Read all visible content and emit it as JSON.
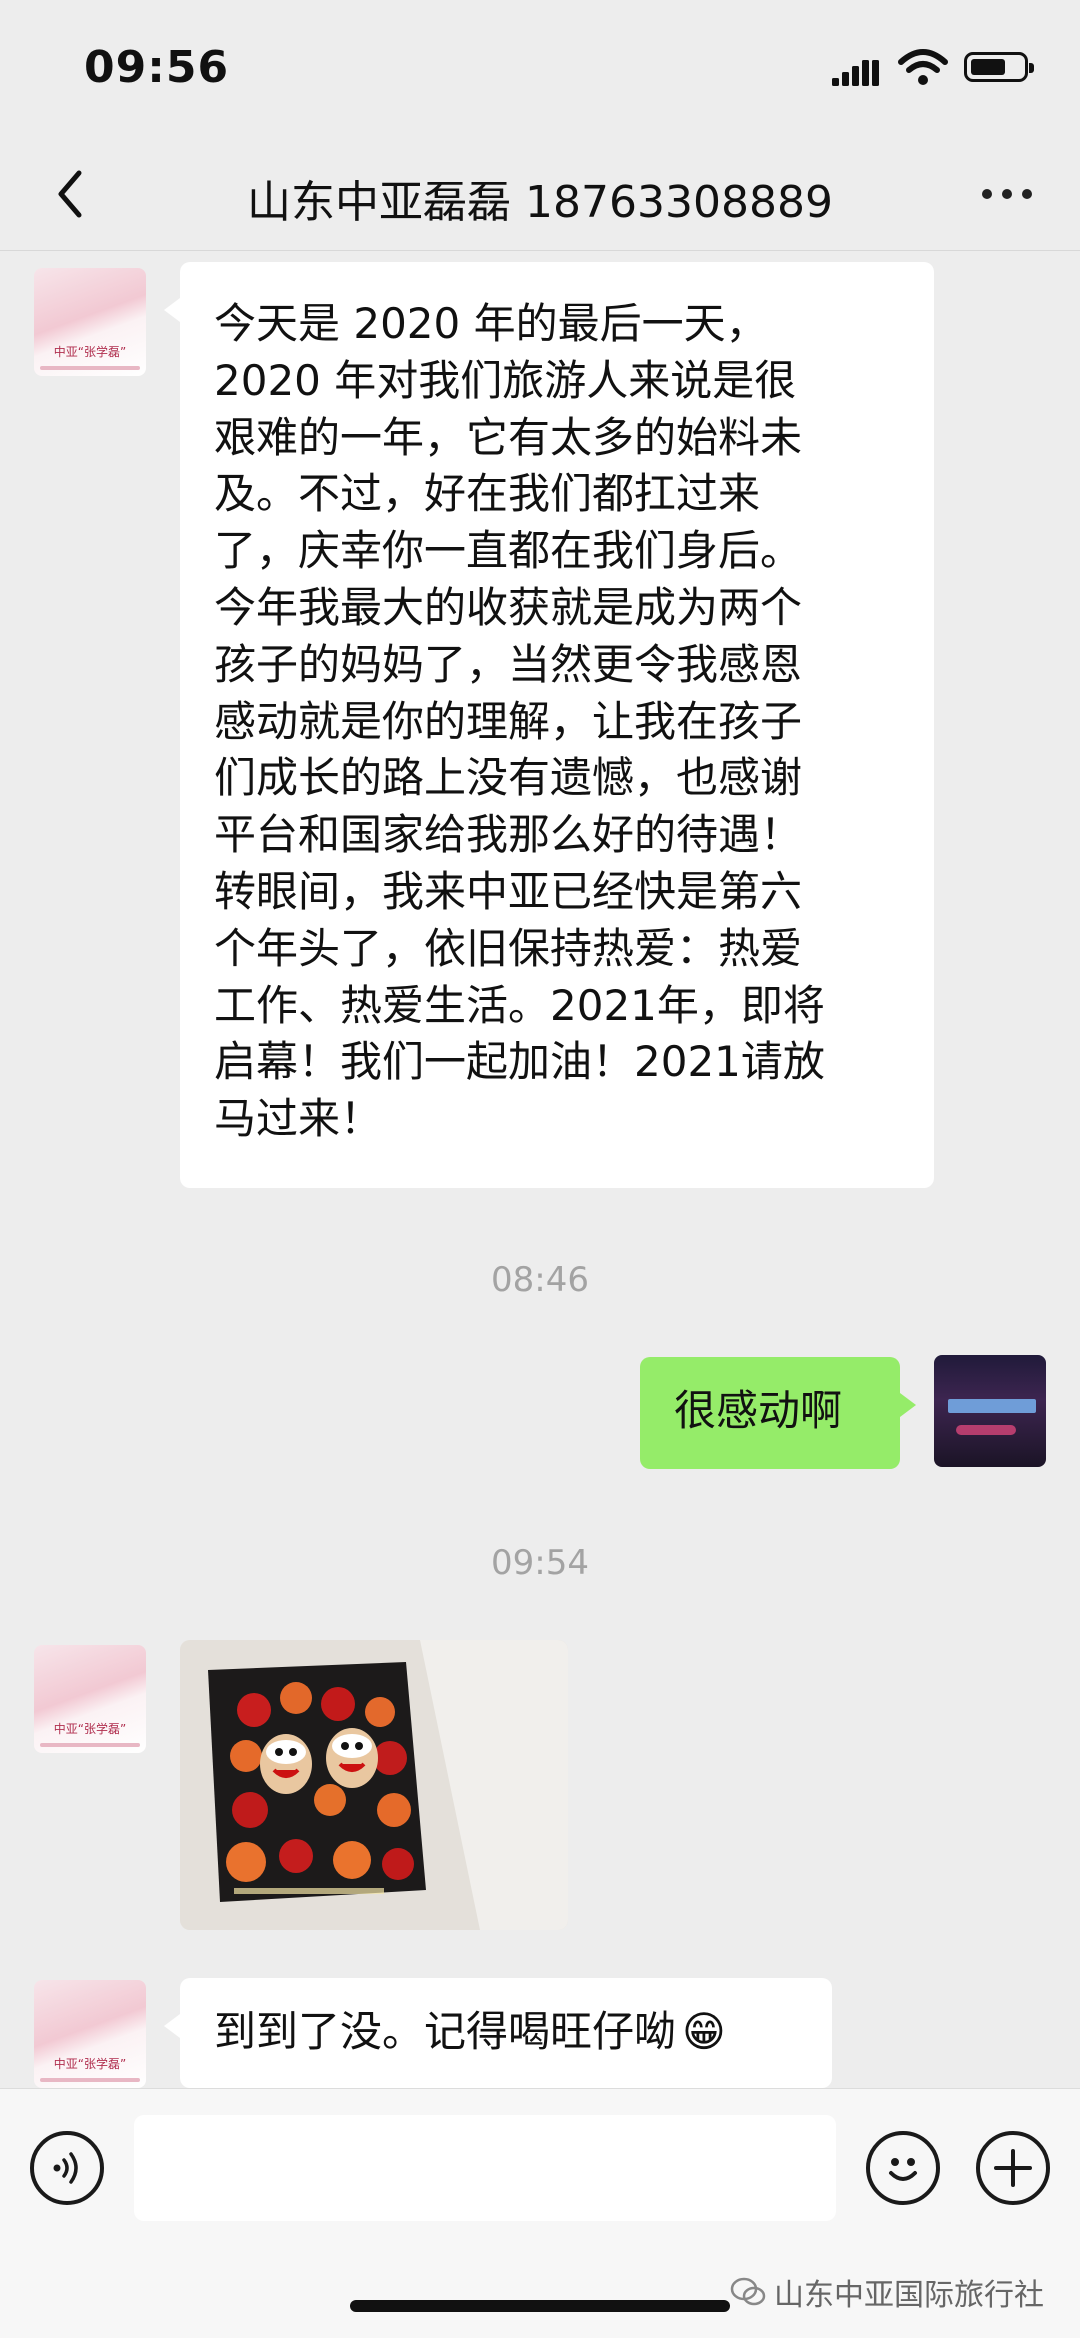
{
  "status_bar": {
    "time": "09:56",
    "icons": [
      "signal-icon",
      "wifi-icon",
      "battery-icon"
    ]
  },
  "nav": {
    "title": "山东中亚磊磊 18763308889",
    "back_icon": "chevron-left-icon",
    "more_icon": "ellipsis-icon"
  },
  "contact_avatar": {
    "caption": "中亚“张学磊”"
  },
  "messages": [
    {
      "side": "in",
      "lines": [
        "今天是 2020 年的最后一天，",
        "2020 年对我们旅游人来说是很",
        "艰难的一年，它有太多的始料未",
        "及。不过，好在我们都扛过来",
        "了，庆幸你一直都在我们身后。",
        "今年我最大的收获就是成为两个",
        "孩子的妈妈了，当然更令我感恩",
        "感动就是你的理解，让我在孩子",
        "们成长的路上没有遗憾，也感谢",
        "平台和国家给我那么好的待遇！",
        "转眼间，我来中亚已经快是第六",
        "个年头了，依旧保持热爱：热爱",
        "工作、热爱生活。2021年，即将",
        "启幕！我们一起加油！2021请放",
        "马过来！"
      ]
    },
    {
      "timestamp": "08:46"
    },
    {
      "side": "out",
      "text": "很感动啊"
    },
    {
      "timestamp": "09:54"
    },
    {
      "side": "in",
      "type": "image",
      "subject": "flower-box-photo"
    },
    {
      "side": "in",
      "text": "到到了没。记得喝旺仔呦",
      "emoji": "😁"
    }
  ],
  "input_bar": {
    "voice_icon": "voice-icon",
    "emoji_icon": "emoji-icon",
    "plus_icon": "plus-icon",
    "value": ""
  },
  "watermark": {
    "text": "山东中亚国际旅行社",
    "icon": "wechat-icon"
  },
  "colors": {
    "background": "#ededed",
    "bubble_in": "#ffffff",
    "bubble_out": "#95ec69",
    "timestamp": "#a3a3a3"
  }
}
